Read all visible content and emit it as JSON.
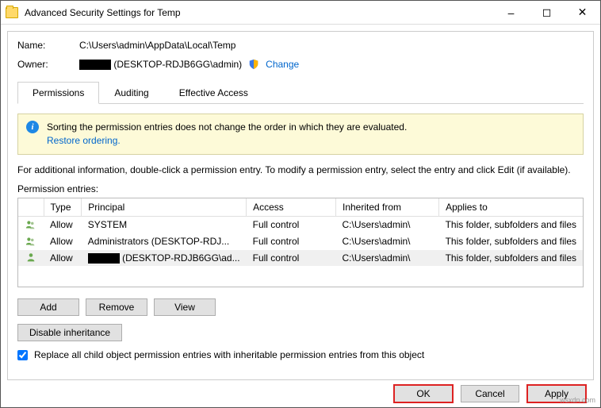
{
  "window": {
    "title": "Advanced Security Settings for Temp"
  },
  "header": {
    "name_label": "Name:",
    "name_value": "C:\\Users\\admin\\AppData\\Local\\Temp",
    "owner_label": "Owner:",
    "owner_value_suffix": "(DESKTOP-RDJB6GG\\admin)",
    "change_link": "Change"
  },
  "tabs": {
    "permissions": "Permissions",
    "auditing": "Auditing",
    "effective": "Effective Access"
  },
  "info": {
    "line1": "Sorting the permission entries does not change the order in which they are evaluated.",
    "restore": "Restore ordering."
  },
  "hint": "For additional information, double-click a permission entry. To modify a permission entry, select the entry and click Edit (if available).",
  "entries_label": "Permission entries:",
  "table": {
    "headers": {
      "type": "Type",
      "principal": "Principal",
      "access": "Access",
      "inherited": "Inherited from",
      "applies": "Applies to"
    },
    "rows": [
      {
        "type": "Allow",
        "principal": "SYSTEM",
        "access": "Full control",
        "inherited": "C:\\Users\\admin\\",
        "applies": "This folder, subfolders and files",
        "redacted": false
      },
      {
        "type": "Allow",
        "principal": "Administrators (DESKTOP-RDJ...",
        "access": "Full control",
        "inherited": "C:\\Users\\admin\\",
        "applies": "This folder, subfolders and files",
        "redacted": false
      },
      {
        "type": "Allow",
        "principal": "(DESKTOP-RDJB6GG\\ad...",
        "access": "Full control",
        "inherited": "C:\\Users\\admin\\",
        "applies": "This folder, subfolders and files",
        "redacted": true
      }
    ]
  },
  "buttons": {
    "add": "Add",
    "remove": "Remove",
    "view": "View",
    "disable_inh": "Disable inheritance",
    "ok": "OK",
    "cancel": "Cancel",
    "apply": "Apply"
  },
  "checkbox": {
    "label": "Replace all child object permission entries with inheritable permission entries from this object"
  },
  "watermark": "wsxdn.com"
}
